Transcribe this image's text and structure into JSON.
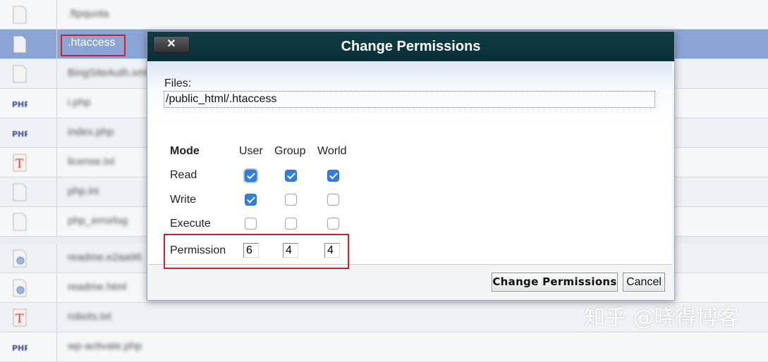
{
  "file_list": {
    "rows": [
      {
        "name": ".ftpquota",
        "icon": "generic-file-icon",
        "style": "plain"
      },
      {
        "name": ".htaccess",
        "icon": "generic-file-icon",
        "style": "selected"
      },
      {
        "name": "BingSiteAuth.xml",
        "icon": "generic-file-icon",
        "style": "alt"
      },
      {
        "name": "i.php",
        "icon": "php-file-icon",
        "style": "plain"
      },
      {
        "name": "index.php",
        "icon": "php-file-icon",
        "style": "alt"
      },
      {
        "name": "license.txt",
        "icon": "text-file-icon",
        "style": "plain"
      },
      {
        "name": "php.ini",
        "icon": "generic-file-icon",
        "style": "alt"
      },
      {
        "name": "php_errorlog",
        "icon": "generic-file-icon",
        "style": "plain"
      },
      {
        "name": "readme.e2aa96",
        "icon": "web-file-icon",
        "style": "alt"
      },
      {
        "name": "readme.html",
        "icon": "web-file-icon",
        "style": "plain"
      },
      {
        "name": "robots.txt",
        "icon": "text-file-icon",
        "style": "alt"
      },
      {
        "name": "wp-activate.php",
        "icon": "php-file-icon",
        "style": "plain"
      }
    ]
  },
  "dialog": {
    "title": "Change Permissions",
    "close_label": "✕",
    "files_label": "Files:",
    "file_path": "/public_html/.htaccess",
    "headers": {
      "mode": "Mode",
      "user": "User",
      "group": "Group",
      "world": "World"
    },
    "permissions": [
      {
        "label": "Read",
        "user": true,
        "group": true,
        "world": true
      },
      {
        "label": "Write",
        "user": true,
        "group": false,
        "world": false
      },
      {
        "label": "Execute",
        "user": false,
        "group": false,
        "world": false
      }
    ],
    "permission_label": "Permission",
    "permission_values": {
      "user": "6",
      "group": "4",
      "world": "4"
    },
    "buttons": {
      "change": "Change Permissions",
      "cancel": "Cancel"
    }
  },
  "watermark": "知乎 @晓得博客",
  "colors": {
    "titlebar": "#0a2f37",
    "selected_row": "#8aa4d6",
    "highlight_border": "#d0202a",
    "checkbox_on": "#2f7fdd"
  }
}
